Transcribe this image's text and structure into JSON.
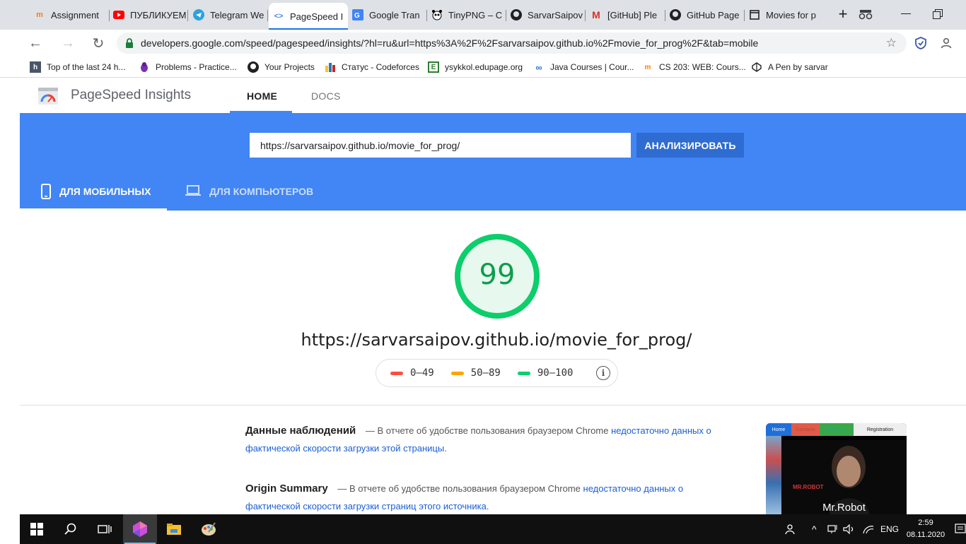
{
  "browser": {
    "tabs": [
      {
        "title": "Assignment",
        "icon": "moodle-icon"
      },
      {
        "title": "ПУБЛИКУЕМ",
        "icon": "youtube-icon"
      },
      {
        "title": "Telegram We",
        "icon": "telegram-icon"
      },
      {
        "title": "PageSpeed I",
        "icon": "pagespeed-icon",
        "active": true
      },
      {
        "title": "Google Tran",
        "icon": "google-translate-icon"
      },
      {
        "title": "TinyPNG – C",
        "icon": "panda-icon"
      },
      {
        "title": "SarvarSaipov",
        "icon": "github-icon"
      },
      {
        "title": "[GitHub] Ple",
        "icon": "gmail-icon"
      },
      {
        "title": "GitHub Page",
        "icon": "github-icon"
      },
      {
        "title": "Movies for p",
        "icon": "page-icon"
      }
    ],
    "address": "developers.google.com/speed/pagespeed/insights/?hl=ru&url=https%3A%2F%2Fsarvarsaipov.github.io%2Fmovie_for_prog%2F&tab=mobile",
    "bookmarks": [
      {
        "label": "Top of the last 24 h...",
        "icon": "hackernews-icon"
      },
      {
        "label": "Problems - Practice...",
        "icon": "codechef-icon"
      },
      {
        "label": "Your Projects",
        "icon": "github-icon"
      },
      {
        "label": "Статус - Codeforces",
        "icon": "codeforces-icon"
      },
      {
        "label": "ysykkol.edupage.org",
        "icon": "edupage-icon"
      },
      {
        "label": "Java Courses | Cour...",
        "icon": "coursera-icon"
      },
      {
        "label": "CS 203: WEB: Cours...",
        "icon": "moodle-icon"
      },
      {
        "label": "A Pen by sarvar",
        "icon": "codepen-icon"
      }
    ]
  },
  "psi": {
    "title": "PageSpeed Insights",
    "nav": {
      "home": "HOME",
      "docs": "DOCS"
    },
    "url_input_value": "https://sarvarsaipov.github.io/movie_for_prog/",
    "analyze_label": "АНАЛИЗИРОВАТЬ",
    "device_tabs": {
      "mobile": "ДЛЯ МОБИЛЬНЫХ",
      "desktop": "ДЛЯ КОМПЬЮТЕРОВ"
    },
    "score": "99",
    "score_fraction": 0.99,
    "tested_url": "https://sarvarsaipov.github.io/movie_for_prog/",
    "legend": [
      {
        "range": "0–49",
        "color": "#ff4e42"
      },
      {
        "range": "50–89",
        "color": "#ffa400"
      },
      {
        "range": "90–100",
        "color": "#0cce6b"
      }
    ],
    "field_data": {
      "heading": "Данные наблюдений",
      "dash_text": "— В отчете об удобстве пользования браузером Chrome",
      "link": "недостаточно данных о фактической скорости загрузки этой страницы."
    },
    "origin_summary": {
      "heading": "Origin Summary",
      "dash_text": "— В отчете об удобстве пользования браузером Chrome",
      "link": "недостаточно данных о фактической скорости загрузки страниц этого источника."
    },
    "thumbnail": {
      "nav": [
        "Home",
        "Contacts",
        "About us",
        "Registration"
      ],
      "tag": "MR.ROBOT",
      "caption": "Mr.Robot"
    }
  },
  "taskbar": {
    "language": "ENG",
    "time": "2:59",
    "date": "08.11.2020"
  },
  "colors": {
    "accent": "#4285f4",
    "pass": "#0cce6b",
    "link": "#1a5fd6"
  }
}
